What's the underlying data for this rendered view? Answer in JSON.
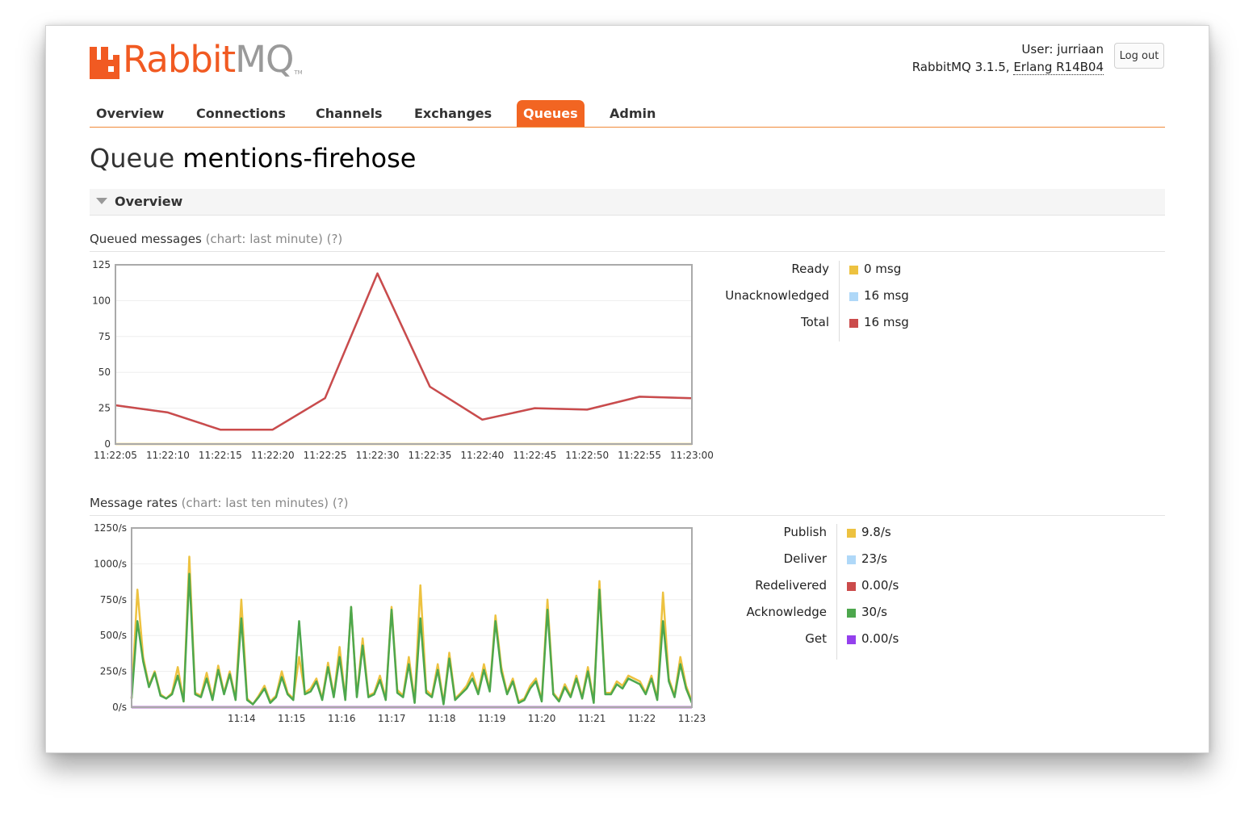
{
  "header": {
    "logo_rabbit": "Rabbit",
    "logo_mq": "MQ",
    "logo_tm": "TM",
    "user_label": "User:",
    "user_name": "jurriaan",
    "version_text": "RabbitMQ 3.1.5,",
    "erlang_text": "Erlang R14B04",
    "logout_label": "Log out"
  },
  "nav": {
    "items": [
      {
        "label": "Overview"
      },
      {
        "label": "Connections"
      },
      {
        "label": "Channels"
      },
      {
        "label": "Exchanges"
      },
      {
        "label": "Queues",
        "active": true
      },
      {
        "label": "Admin"
      }
    ]
  },
  "page": {
    "title_prefix": "Queue",
    "queue_name": "mentions-firehose",
    "section_label": "Overview"
  },
  "queued": {
    "heading": "Queued messages",
    "chart_note": "(chart: last minute)",
    "help": "(?)",
    "legend": [
      {
        "label": "Ready",
        "value": "0 msg",
        "color": "#edc240"
      },
      {
        "label": "Unacknowledged",
        "value": "16 msg",
        "color": "#afd8f8"
      },
      {
        "label": "Total",
        "value": "16 msg",
        "color": "#cb4b4b"
      }
    ]
  },
  "rates": {
    "heading": "Message rates",
    "chart_note": "(chart: last ten minutes)",
    "help": "(?)",
    "legend": [
      {
        "label": "Publish",
        "value": "9.8/s",
        "color": "#edc240"
      },
      {
        "label": "Deliver",
        "value": "23/s",
        "color": "#afd8f8"
      },
      {
        "label": "Redelivered",
        "value": "0.00/s",
        "color": "#cb4b4b"
      },
      {
        "label": "Acknowledge",
        "value": "30/s",
        "color": "#4da74d"
      },
      {
        "label": "Get",
        "value": "0.00/s",
        "color": "#9440ed"
      }
    ]
  },
  "chart_data": [
    {
      "type": "line",
      "title": "Queued messages",
      "x": [
        "11:22:05",
        "11:22:10",
        "11:22:15",
        "11:22:20",
        "11:22:25",
        "11:22:30",
        "11:22:35",
        "11:22:40",
        "11:22:45",
        "11:22:50",
        "11:22:55",
        "11:23:00"
      ],
      "ylim": [
        0,
        125
      ],
      "yticks": [
        0,
        25,
        50,
        75,
        100,
        125
      ],
      "series": [
        {
          "name": "Ready",
          "color": "#edc240",
          "values": [
            0,
            0,
            0,
            0,
            0,
            0,
            0,
            0,
            0,
            0,
            0,
            0
          ]
        },
        {
          "name": "Unacknowledged",
          "color": "#afd8f8",
          "values": [
            27,
            22,
            10,
            10,
            32,
            119,
            40,
            17,
            25,
            24,
            33,
            32
          ]
        },
        {
          "name": "Total",
          "color": "#cb4b4b",
          "values": [
            27,
            22,
            10,
            10,
            32,
            119,
            40,
            17,
            25,
            24,
            33,
            32
          ]
        }
      ]
    },
    {
      "type": "line",
      "title": "Message rates",
      "x": [
        "11:14",
        "11:15",
        "11:16",
        "11:17",
        "11:18",
        "11:19",
        "11:20",
        "11:21",
        "11:22",
        "11:23"
      ],
      "x_range": [
        11.8,
        23.0
      ],
      "ylim": [
        0,
        1250
      ],
      "yticks": [
        "0/s",
        "250/s",
        "500/s",
        "750/s",
        "1000/s",
        "1250/s"
      ],
      "ytick_values": [
        0,
        250,
        500,
        750,
        1000,
        1250
      ],
      "series": [
        {
          "name": "Publish",
          "color": "#edc240",
          "values": [
            60,
            820,
            350,
            150,
            250,
            90,
            60,
            100,
            280,
            40,
            1050,
            100,
            80,
            240,
            60,
            290,
            100,
            250,
            60,
            750,
            60,
            20,
            80,
            150,
            40,
            80,
            250,
            100,
            60,
            350,
            100,
            130,
            200,
            60,
            310,
            80,
            420,
            60,
            700,
            80,
            480,
            80,
            100,
            220,
            60,
            700,
            120,
            80,
            350,
            40,
            850,
            120,
            80,
            300,
            30,
            380,
            60,
            100,
            150,
            240,
            100,
            300,
            120,
            640,
            280,
            100,
            200,
            40,
            60,
            150,
            200,
            50,
            750,
            100,
            50,
            160,
            80,
            220,
            70,
            280,
            40,
            880,
            100,
            100,
            180,
            150,
            220,
            200,
            180,
            100,
            220,
            60,
            800,
            200,
            80,
            350,
            150,
            40
          ]
        },
        {
          "name": "Deliver",
          "color": "#afd8f8",
          "values": [
            0,
            0,
            0,
            0,
            0,
            0,
            0,
            0,
            0,
            0,
            0,
            0,
            0,
            0,
            0,
            0,
            0,
            0,
            0,
            0,
            0,
            0,
            0,
            0,
            0,
            0,
            0,
            0,
            0,
            0,
            0,
            0,
            0,
            0,
            0,
            0,
            0,
            0,
            0,
            0,
            0,
            0,
            0,
            0,
            0,
            0,
            0,
            0,
            0,
            0,
            0,
            0,
            0,
            0,
            0,
            0,
            0,
            0,
            0,
            0,
            0,
            0,
            0,
            0,
            0,
            0,
            0,
            0,
            0,
            0,
            0,
            0,
            0,
            0,
            0,
            0,
            0,
            0,
            0,
            0,
            0,
            0,
            0,
            0,
            0,
            0,
            0,
            0,
            0,
            0,
            0,
            0,
            0,
            0,
            0,
            0,
            0,
            0
          ]
        },
        {
          "name": "Redelivered",
          "color": "#cb4b4b",
          "values": [
            0,
            0,
            0,
            0,
            0,
            0,
            0,
            0,
            0,
            0,
            0,
            0,
            0,
            0,
            0,
            0,
            0,
            0,
            0,
            0,
            0,
            0,
            0,
            0,
            0,
            0,
            0,
            0,
            0,
            0,
            0,
            0,
            0,
            0,
            0,
            0,
            0,
            0,
            0,
            0,
            0,
            0,
            0,
            0,
            0,
            0,
            0,
            0,
            0,
            0,
            0,
            0,
            0,
            0,
            0,
            0,
            0,
            0,
            0,
            0,
            0,
            0,
            0,
            0,
            0,
            0,
            0,
            0,
            0,
            0,
            0,
            0,
            0,
            0,
            0,
            0,
            0,
            0,
            0,
            0,
            0,
            0,
            0,
            0,
            0,
            0,
            0,
            0,
            0,
            0,
            0,
            0,
            0,
            0,
            0,
            0,
            0,
            0
          ]
        },
        {
          "name": "Acknowledge",
          "color": "#4da74d",
          "values": [
            60,
            600,
            320,
            140,
            240,
            80,
            60,
            90,
            220,
            40,
            930,
            90,
            70,
            200,
            50,
            260,
            90,
            230,
            50,
            620,
            50,
            20,
            70,
            130,
            30,
            70,
            210,
            90,
            50,
            600,
            90,
            110,
            180,
            50,
            280,
            70,
            350,
            50,
            700,
            70,
            430,
            70,
            90,
            190,
            50,
            680,
            100,
            70,
            300,
            30,
            620,
            100,
            70,
            260,
            20,
            340,
            50,
            90,
            130,
            200,
            90,
            260,
            110,
            600,
            250,
            90,
            180,
            30,
            50,
            130,
            180,
            40,
            680,
            90,
            40,
            140,
            70,
            200,
            60,
            250,
            30,
            820,
            90,
            90,
            160,
            130,
            200,
            180,
            160,
            90,
            200,
            50,
            600,
            180,
            70,
            300,
            130,
            30
          ]
        },
        {
          "name": "Get",
          "color": "#9440ed",
          "values": [
            0,
            0,
            0,
            0,
            0,
            0,
            0,
            0,
            0,
            0,
            0,
            0,
            0,
            0,
            0,
            0,
            0,
            0,
            0,
            0,
            0,
            0,
            0,
            0,
            0,
            0,
            0,
            0,
            0,
            0,
            0,
            0,
            0,
            0,
            0,
            0,
            0,
            0,
            0,
            0,
            0,
            0,
            0,
            0,
            0,
            0,
            0,
            0,
            0,
            0,
            0,
            0,
            0,
            0,
            0,
            0,
            0,
            0,
            0,
            0,
            0,
            0,
            0,
            0,
            0,
            0,
            0,
            0,
            0,
            0,
            0,
            0,
            0,
            0,
            0,
            0,
            0,
            0,
            0,
            0,
            0,
            0,
            0,
            0,
            0,
            0,
            0,
            0,
            0,
            0,
            0,
            0,
            0,
            0,
            0,
            0,
            0,
            0
          ]
        }
      ]
    }
  ]
}
